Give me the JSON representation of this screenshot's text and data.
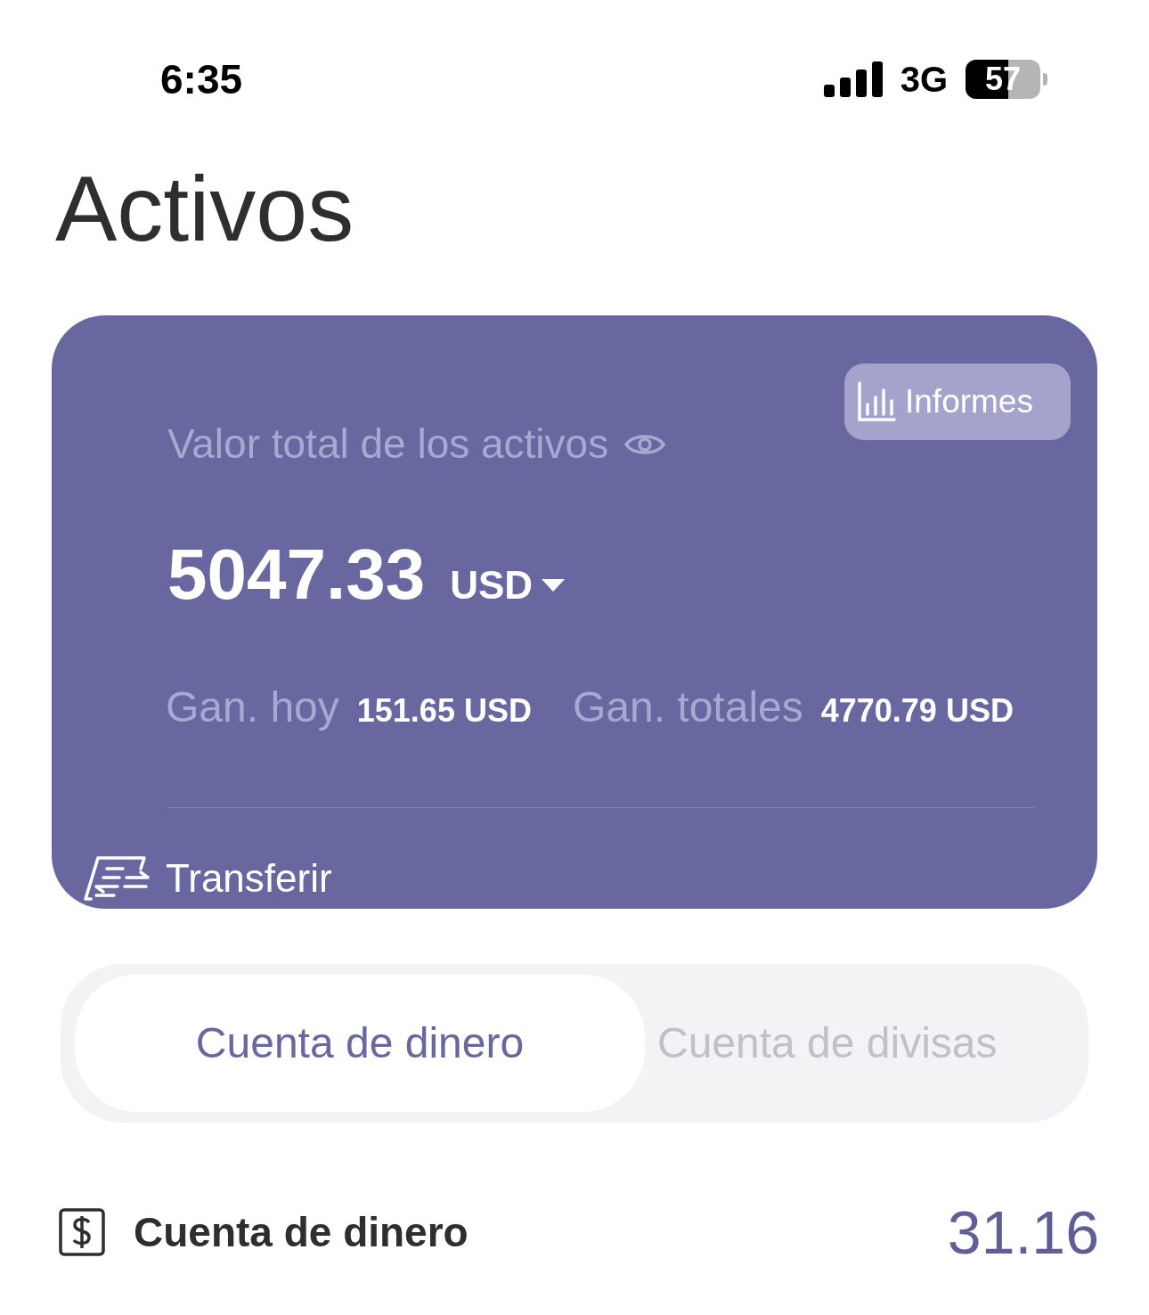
{
  "status_bar": {
    "time": "6:35",
    "network": "3G",
    "battery": {
      "label": "57",
      "level": 0.57
    }
  },
  "title": "Activos",
  "summary_card": {
    "label": "Valor total de los activos",
    "reports_button": "Informes",
    "amount": "5047.33",
    "currency": "USD",
    "gains": [
      {
        "label": "Gan. hoy",
        "value": "151.65 USD"
      },
      {
        "label": "Gan. totales",
        "value": "4770.79 USD"
      }
    ],
    "transfer_button": "Transferir"
  },
  "tabs": [
    {
      "label": "Cuenta de dinero",
      "selected": true
    },
    {
      "label": "Cuenta de divisas",
      "selected": false
    }
  ],
  "account_row": {
    "name": "Cuenta de dinero",
    "value": "31.16"
  }
}
